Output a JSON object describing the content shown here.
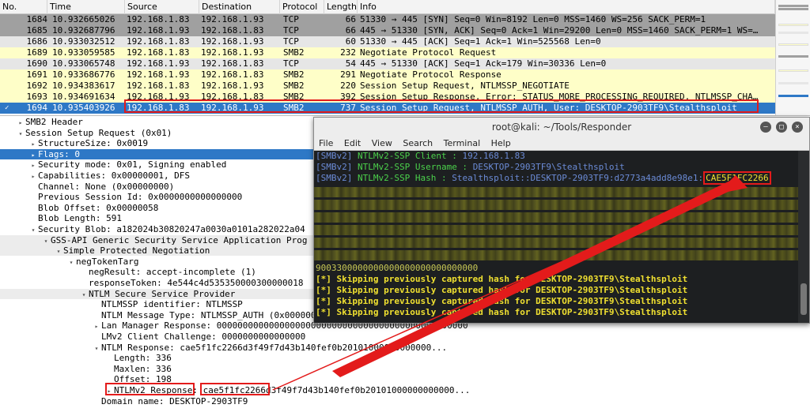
{
  "columns": [
    "No.",
    "Time",
    "Source",
    "Destination",
    "Protocol",
    "Length",
    "Info"
  ],
  "packets": [
    {
      "no": "1684",
      "time": "10.932665026",
      "src": "192.168.1.83",
      "dst": "192.168.1.93",
      "proto": "TCP",
      "len": "66",
      "info": "51330 → 445 [SYN] Seq=0 Win=8192 Len=0 MSS=1460 WS=256 SACK_PERM=1",
      "bg": "#a0a0a0",
      "fg": "#000000"
    },
    {
      "no": "1685",
      "time": "10.932687796",
      "src": "192.168.1.93",
      "dst": "192.168.1.83",
      "proto": "TCP",
      "len": "66",
      "info": "445 → 51330 [SYN, ACK] Seq=0 Ack=1 Win=29200 Len=0 MSS=1460 SACK_PERM=1 WS=…",
      "bg": "#a0a0a0",
      "fg": "#000000"
    },
    {
      "no": "1686",
      "time": "10.933032512",
      "src": "192.168.1.83",
      "dst": "192.168.1.93",
      "proto": "TCP",
      "len": "60",
      "info": "51330 → 445 [ACK] Seq=1 Ack=1 Win=525568 Len=0",
      "bg": "#e6e6e6",
      "fg": "#000000"
    },
    {
      "no": "1689",
      "time": "10.933059585",
      "src": "192.168.1.83",
      "dst": "192.168.1.93",
      "proto": "SMB2",
      "len": "232",
      "info": "Negotiate Protocol Request",
      "bg": "#fefec8",
      "fg": "#000000"
    },
    {
      "no": "1690",
      "time": "10.933065748",
      "src": "192.168.1.93",
      "dst": "192.168.1.83",
      "proto": "TCP",
      "len": "54",
      "info": "445 → 51330 [ACK] Seq=1 Ack=179 Win=30336 Len=0",
      "bg": "#e6e6e6",
      "fg": "#000000"
    },
    {
      "no": "1691",
      "time": "10.933686776",
      "src": "192.168.1.93",
      "dst": "192.168.1.83",
      "proto": "SMB2",
      "len": "291",
      "info": "Negotiate Protocol Response",
      "bg": "#fefec8",
      "fg": "#000000"
    },
    {
      "no": "1692",
      "time": "10.934383617",
      "src": "192.168.1.83",
      "dst": "192.168.1.93",
      "proto": "SMB2",
      "len": "220",
      "info": "Session Setup Request, NTLMSSP_NEGOTIATE",
      "bg": "#fefec8",
      "fg": "#000000"
    },
    {
      "no": "1693",
      "time": "10.934691634",
      "src": "192.168.1.93",
      "dst": "192.168.1.83",
      "proto": "SMB2",
      "len": "392",
      "info": "Session Setup Response, Error: STATUS_MORE_PROCESSING_REQUIRED, NTLMSSP_CHA…",
      "bg": "#fefec8",
      "fg": "#000000"
    },
    {
      "no": "1694",
      "time": "10.935403926",
      "src": "192.168.1.83",
      "dst": "192.168.1.93",
      "proto": "SMB2",
      "len": "737",
      "info": "Session Setup Request, NTLMSSP_AUTH, User: DESKTOP-2903TF9\\Stealthsploit",
      "bg": "#2e78c6",
      "fg": "#ffffff"
    }
  ],
  "details": [
    {
      "indent": 0,
      "tri": "▸",
      "text": "SMB2 Header"
    },
    {
      "indent": 0,
      "tri": "▾",
      "text": "Session Setup Request (0x01)"
    },
    {
      "indent": 1,
      "tri": "▸",
      "text": "StructureSize: 0x0019"
    },
    {
      "indent": 1,
      "tri": "▸",
      "text": "Flags: 0"
    },
    {
      "indent": 1,
      "tri": "▸",
      "text": "Security mode: 0x01, Signing enabled"
    },
    {
      "indent": 1,
      "tri": "▸",
      "text": "Capabilities: 0x00000001, DFS"
    },
    {
      "indent": 1,
      "tri": "",
      "text": "Channel: None (0x00000000)"
    },
    {
      "indent": 1,
      "tri": "",
      "text": "Previous Session Id: 0x0000000000000000"
    },
    {
      "indent": 1,
      "tri": "",
      "text": "Blob Offset: 0x00000058"
    },
    {
      "indent": 1,
      "tri": "",
      "text": "Blob Length: 591"
    },
    {
      "indent": 1,
      "tri": "▾",
      "text": "Security Blob: a182024b30820247a0030a0101a282022a04"
    },
    {
      "indent": 2,
      "tri": "▾",
      "text": "GSS-API Generic Security Service Application Prog"
    },
    {
      "indent": 3,
      "tri": "▾",
      "text": "Simple Protected Negotiation"
    },
    {
      "indent": 4,
      "tri": "▾",
      "text": "negTokenTarg"
    },
    {
      "indent": 5,
      "tri": "",
      "text": "negResult: accept-incomplete (1)"
    },
    {
      "indent": 5,
      "tri": "",
      "text": "responseToken: 4e544c4d535350000300000018"
    },
    {
      "indent": 5,
      "tri": "▾",
      "text": "NTLM Secure Service Provider"
    },
    {
      "indent": 6,
      "tri": "",
      "text": "NTLMSSP identifier: NTLMSSP"
    },
    {
      "indent": 6,
      "tri": "",
      "text": "NTLM Message Type: NTLMSSP_AUTH (0x00000003)"
    },
    {
      "indent": 6,
      "tri": "▸",
      "text": "Lan Manager Response: 000000000000000000000000000000000000000000000000"
    },
    {
      "indent": 6,
      "tri": "",
      "text": "LMv2 Client Challenge: 0000000000000000"
    },
    {
      "indent": 6,
      "tri": "▾",
      "text": "NTLM Response: cae5f1fc2266d3f49f7d43b140fef0b20101000000000000..."
    },
    {
      "indent": 7,
      "tri": "",
      "text": "Length: 336"
    },
    {
      "indent": 7,
      "tri": "",
      "text": "Maxlen: 336"
    },
    {
      "indent": 7,
      "tri": "",
      "text": "Offset: 198"
    },
    {
      "indent": 7,
      "tri": "▸",
      "text": "NTLMv2 Response: cae5f1fc2266d3f49f7d43b140fef0b20101000000000000..."
    },
    {
      "indent": 6,
      "tri": "",
      "text": "Domain name: DESKTOP-2903TF9"
    }
  ],
  "terminal": {
    "title": "root@kali: ~/Tools/Responder",
    "menu": [
      "File",
      "Edit",
      "View",
      "Search",
      "Terminal",
      "Help"
    ],
    "lines": [
      {
        "tag": "[SMBv2]",
        "label": "NTLMv2-SSP Client   :",
        "value": "192.168.1.83"
      },
      {
        "tag": "[SMBv2]",
        "label": "NTLMv2-SSP Username :",
        "value": "DESKTOP-2903TF9\\Stealthsploit"
      },
      {
        "tag": "[SMBv2]",
        "label": "NTLMv2-SSP Hash     :",
        "value": "Stealthsploit::DESKTOP-2903TF9:d2773a4add8e98e1:",
        "hash": "CAE5F1FC2266"
      }
    ],
    "tail_hex": "9003300000000000000000000000000",
    "skip_lines": [
      "[*] Skipping previously captured hash for DESKTOP-2903TF9\\Stealthsploit",
      "[*] Skipping previously captured hash for DESKTOP-2903TF9\\Stealthsploit",
      "[*] Skipping previously captured hash for DESKTOP-2903TF9\\Stealthsploit",
      "[*] Skipping previously captured hash for DESKTOP-2903TF9\\Stealthsploit"
    ]
  },
  "colors": {
    "accent": "#e31b1b",
    "selection": "#2e78c6",
    "term_blue": "#6b8bd6",
    "term_green": "#4bd14b",
    "term_yellow": "#f0e030"
  }
}
